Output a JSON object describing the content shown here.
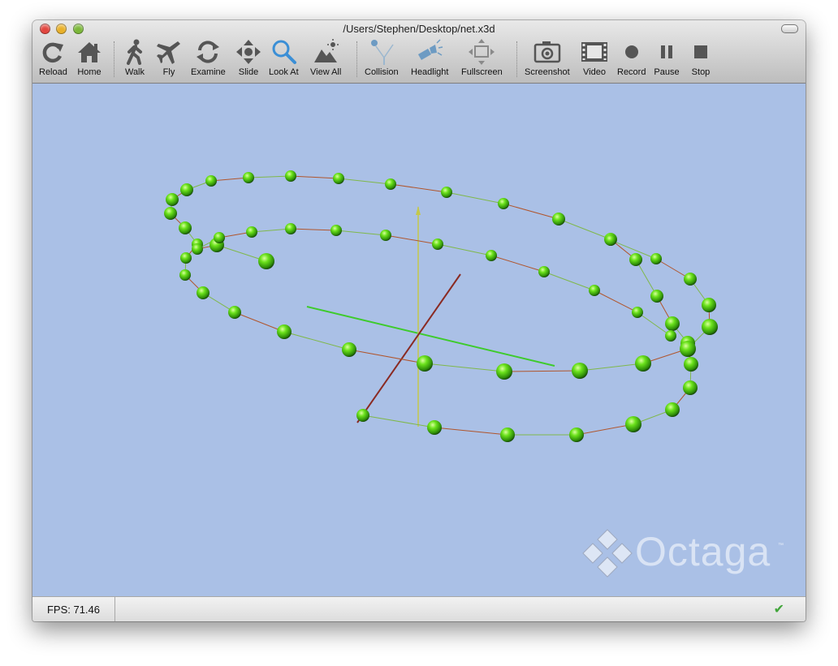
{
  "window": {
    "title": "/Users/Stephen/Desktop/net.x3d"
  },
  "toolbar": {
    "items": [
      {
        "label": "Reload",
        "icon": "reload-icon"
      },
      {
        "label": "Home",
        "icon": "home-icon"
      },
      {
        "label": "Walk",
        "icon": "walk-icon"
      },
      {
        "label": "Fly",
        "icon": "airplane-icon"
      },
      {
        "label": "Examine",
        "icon": "rotate-icon"
      },
      {
        "label": "Slide",
        "icon": "move-arrows-icon"
      },
      {
        "label": "Look At",
        "icon": "magnifier-icon"
      },
      {
        "label": "View All",
        "icon": "landscape-icon"
      },
      {
        "label": "Collision",
        "icon": "collision-icon"
      },
      {
        "label": "Headlight",
        "icon": "flashlight-icon"
      },
      {
        "label": "Fullscreen",
        "icon": "fullscreen-icon"
      },
      {
        "label": "Screenshot",
        "icon": "camera-icon"
      },
      {
        "label": "Video",
        "icon": "film-icon"
      },
      {
        "label": "Record",
        "icon": "record-icon"
      },
      {
        "label": "Pause",
        "icon": "pause-icon"
      },
      {
        "label": "Stop",
        "icon": "stop-icon"
      }
    ]
  },
  "viewport": {
    "background": "#aac0e6",
    "node_color": "#4fd21a",
    "edge_color_a": "#b0552c",
    "edge_color_b": "#7fb84a"
  },
  "status": {
    "fps": "FPS: 71.46",
    "status_icon": "checkmark-icon"
  },
  "logo": {
    "text": "Octaga",
    "tm": "™"
  }
}
